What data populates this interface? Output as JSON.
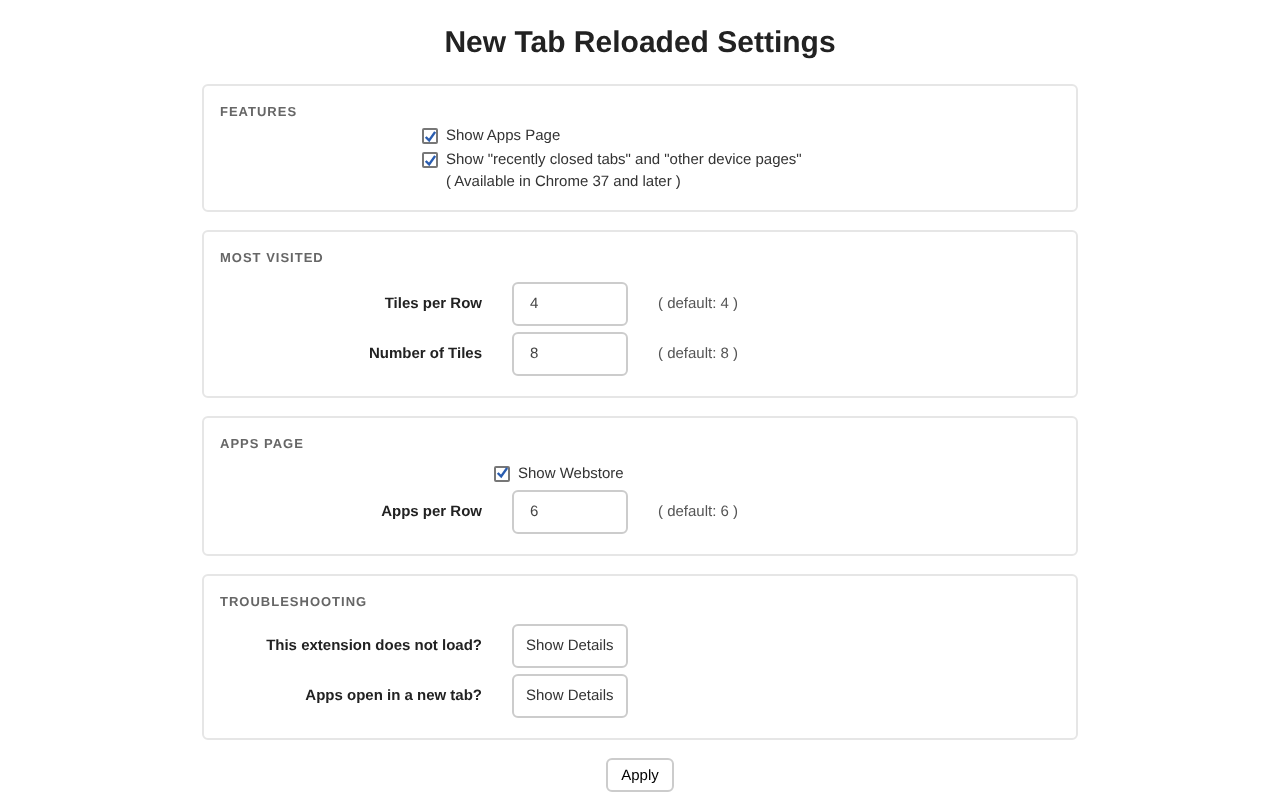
{
  "title": "New Tab Reloaded Settings",
  "sections": [
    {
      "title": "FEATURES",
      "rows": [
        {
          "kind": "checkbox",
          "label": "Show Apps Page",
          "checked": true
        },
        {
          "kind": "checkbox",
          "label": "Show \"recently closed tabs\" and \"other device pages\"",
          "checked": true,
          "note": "( Available in Chrome 37 and later )"
        }
      ]
    },
    {
      "title": "MOST VISITED",
      "rows": [
        {
          "kind": "number",
          "label": "Tiles per Row",
          "value": "4",
          "hint": "( default: 4 )"
        },
        {
          "kind": "number",
          "label": "Number of Tiles",
          "value": "8",
          "hint": "( default: 8 )"
        }
      ]
    },
    {
      "title": "APPS PAGE",
      "rows": [
        {
          "kind": "checkbox",
          "label": "Show Webstore",
          "checked": true
        },
        {
          "kind": "number",
          "label": "Apps per Row",
          "value": "6",
          "hint": "( default: 6 )"
        }
      ]
    },
    {
      "title": "TROUBLESHOOTING",
      "rows": [
        {
          "kind": "button",
          "label": "This extension does not load?",
          "button": "Show Details"
        },
        {
          "kind": "button",
          "label": "Apps open in a new tab?",
          "button": "Show Details"
        }
      ]
    }
  ],
  "apply": "Apply"
}
